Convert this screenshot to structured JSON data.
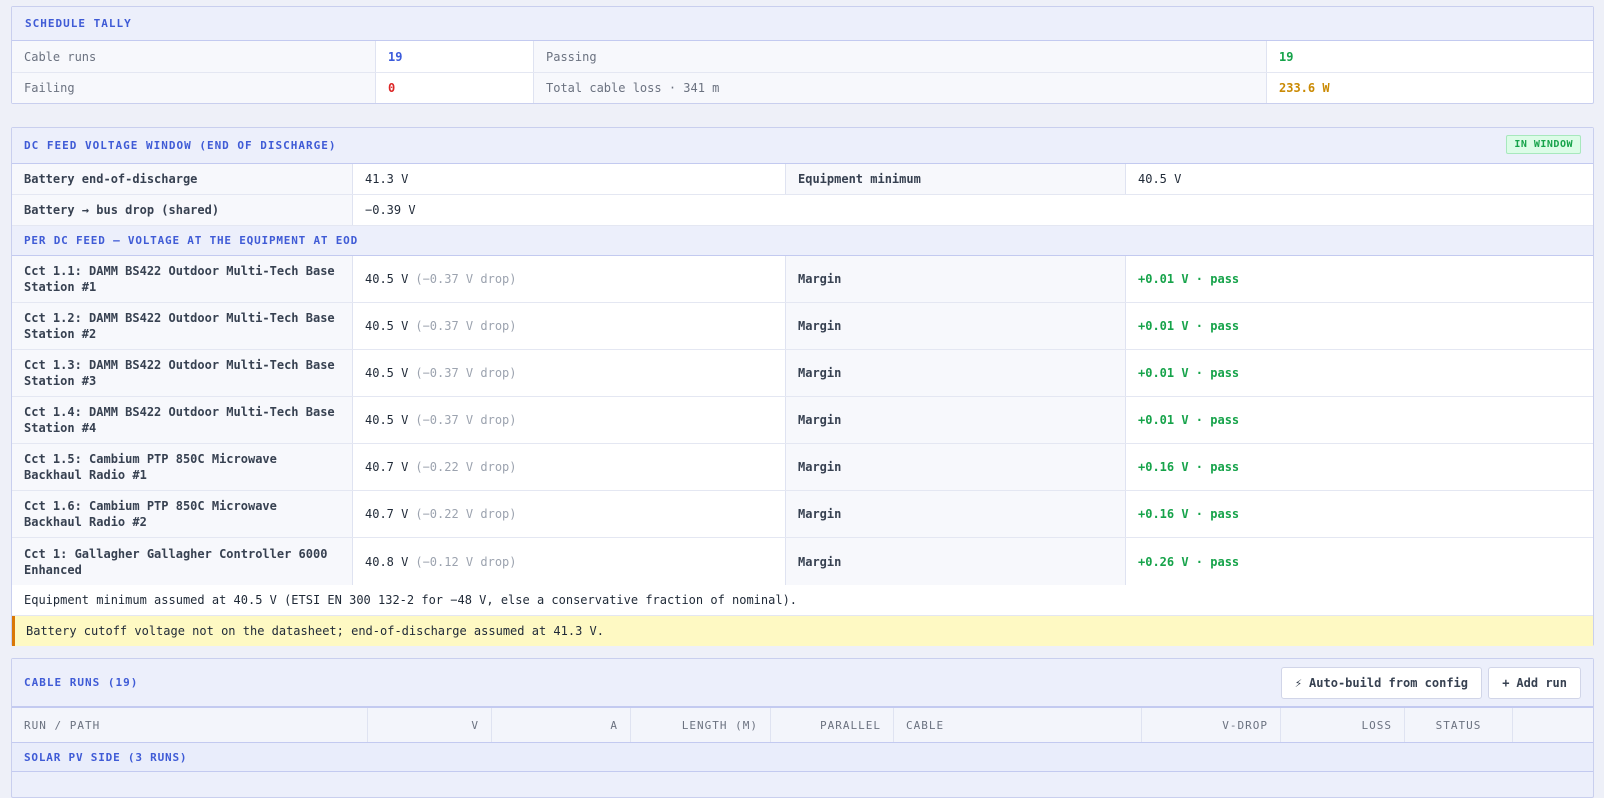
{
  "tally": {
    "title": "SCHEDULE TALLY",
    "cable_runs_label": "Cable runs",
    "cable_runs_value": "19",
    "passing_label": "Passing",
    "passing_value": "19",
    "failing_label": "Failing",
    "failing_value": "0",
    "loss_label": "Total cable loss · 341 m",
    "loss_value": "233.6 W"
  },
  "dcfeed": {
    "title": "DC FEED VOLTAGE WINDOW (END OF DISCHARGE)",
    "badge": "IN WINDOW",
    "battery_eod_label": "Battery end-of-discharge",
    "battery_eod_value": "41.3 V",
    "equip_min_label": "Equipment minimum",
    "equip_min_value": "40.5 V",
    "bus_drop_label": "Battery → bus drop (shared)",
    "bus_drop_value": "−0.39 V",
    "per_feed_title": "PER DC FEED — VOLTAGE AT THE EQUIPMENT AT EOD",
    "feeds": [
      {
        "name": "Cct 1.1: DAMM BS422 Outdoor Multi-Tech Base Station #1",
        "voltage": "40.5 V",
        "drop": "(−0.37 V drop)",
        "margin_label": "Margin",
        "margin": "+0.01 V · pass"
      },
      {
        "name": "Cct 1.2: DAMM BS422 Outdoor Multi-Tech Base Station #2",
        "voltage": "40.5 V",
        "drop": "(−0.37 V drop)",
        "margin_label": "Margin",
        "margin": "+0.01 V · pass"
      },
      {
        "name": "Cct 1.3: DAMM BS422 Outdoor Multi-Tech Base Station #3",
        "voltage": "40.5 V",
        "drop": "(−0.37 V drop)",
        "margin_label": "Margin",
        "margin": "+0.01 V · pass"
      },
      {
        "name": "Cct 1.4: DAMM BS422 Outdoor Multi-Tech Base Station #4",
        "voltage": "40.5 V",
        "drop": "(−0.37 V drop)",
        "margin_label": "Margin",
        "margin": "+0.01 V · pass"
      },
      {
        "name": "Cct 1.5: Cambium PTP 850C Microwave Backhaul Radio #1",
        "voltage": "40.7 V",
        "drop": "(−0.22 V drop)",
        "margin_label": "Margin",
        "margin": "+0.16 V · pass"
      },
      {
        "name": "Cct 1.6: Cambium PTP 850C Microwave Backhaul Radio #2",
        "voltage": "40.7 V",
        "drop": "(−0.22 V drop)",
        "margin_label": "Margin",
        "margin": "+0.16 V · pass"
      },
      {
        "name": "Cct 1: Gallagher Gallagher Controller 6000 Enhanced",
        "voltage": "40.8 V",
        "drop": "(−0.12 V drop)",
        "margin_label": "Margin",
        "margin": "+0.26 V · pass"
      }
    ],
    "note": "Equipment minimum assumed at 40.5 V (ETSI EN 300 132-2 for −48 V, else a conservative fraction of nominal).",
    "warning": "Battery cutoff voltage not on the datasheet; end-of-discharge assumed at 41.3 V."
  },
  "cable_runs": {
    "title": "CABLE RUNS (19)",
    "autobuild_icon": "⚡",
    "autobuild_label": "Auto-build from config",
    "add_icon": "+",
    "add_label": "Add run",
    "columns": [
      "RUN / PATH",
      "V",
      "A",
      "LENGTH (M)",
      "PARALLEL",
      "CABLE",
      "V-DROP",
      "LOSS",
      "STATUS"
    ],
    "group_title": "SOLAR PV SIDE (3 RUNS)"
  }
}
